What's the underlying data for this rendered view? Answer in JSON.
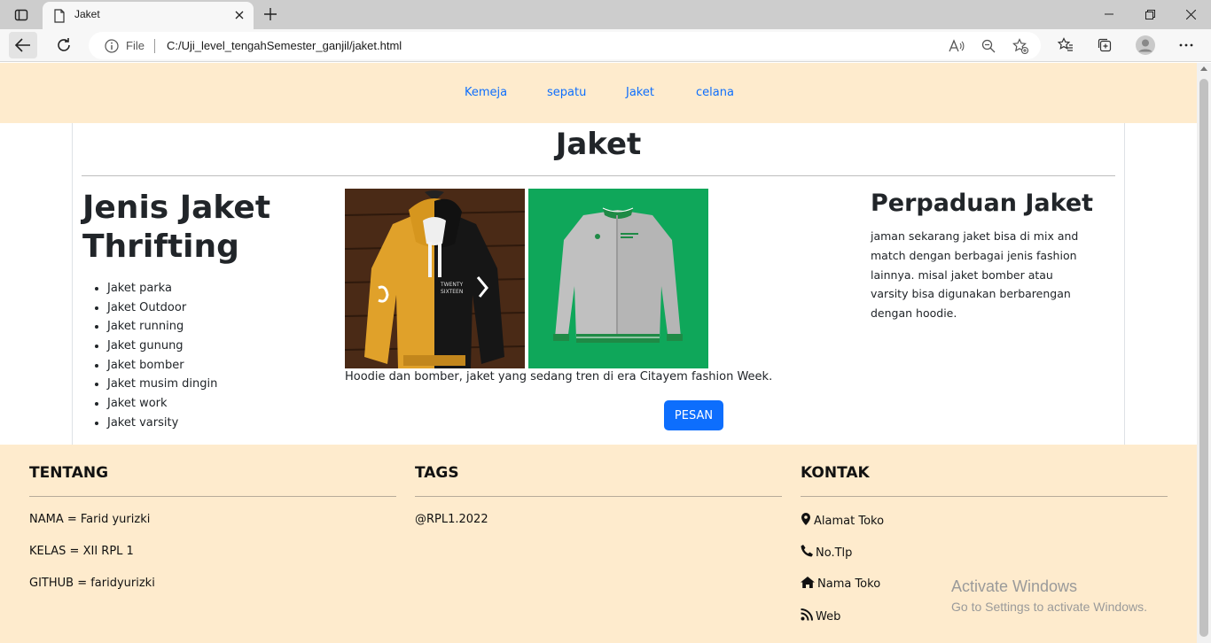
{
  "browser": {
    "tab_title": "Jaket",
    "address_label": "File",
    "url": "C:/Uji_level_tengahSemester_ganjil/jaket.html"
  },
  "nav": {
    "items": [
      {
        "label": "Kemeja"
      },
      {
        "label": "sepatu"
      },
      {
        "label": "Jaket"
      },
      {
        "label": "celana"
      }
    ]
  },
  "main": {
    "title": "Jaket",
    "left_heading": "Jenis Jaket Thrifting",
    "list": [
      "Jaket parka",
      "Jaket Outdoor",
      "Jaket running",
      "Jaket gunung",
      "Jaket bomber",
      "Jaket musim dingin",
      "Jaket work",
      "Jaket varsity"
    ],
    "caption": "Hoodie dan bomber, jaket yang sedang tren di era Citayem fashion Week.",
    "button_label": "PESAN",
    "right_heading": "Perpaduan Jaket",
    "right_text": "jaman sekarang jaket bisa di mix and match dengan berbagai jenis fashion lainnya. misal jaket bomber atau varsity bisa digunakan berbarengan dengan hoodie."
  },
  "footer": {
    "tentang": {
      "title": "TENTANG",
      "items": [
        "NAMA = Farid yurizki",
        "KELAS = XII RPL 1",
        "GITHUB = faridyurizki"
      ]
    },
    "tags": {
      "title": "TAGS",
      "items": [
        "@RPL1.2022"
      ]
    },
    "kontak": {
      "title": "KONTAK",
      "items": [
        {
          "label": "Alamat Toko",
          "icon": "map-marker-icon"
        },
        {
          "label": "No.Tlp",
          "icon": "phone-icon"
        },
        {
          "label": "Nama Toko",
          "icon": "home-icon"
        },
        {
          "label": "Web",
          "icon": "web-icon"
        }
      ]
    }
  },
  "watermark": {
    "line1": "Activate Windows",
    "line2": "Go to Settings to activate Windows."
  },
  "colors": {
    "nav_bg": "#feebcd",
    "link": "#0d6efd",
    "button": "#0d6efd"
  }
}
